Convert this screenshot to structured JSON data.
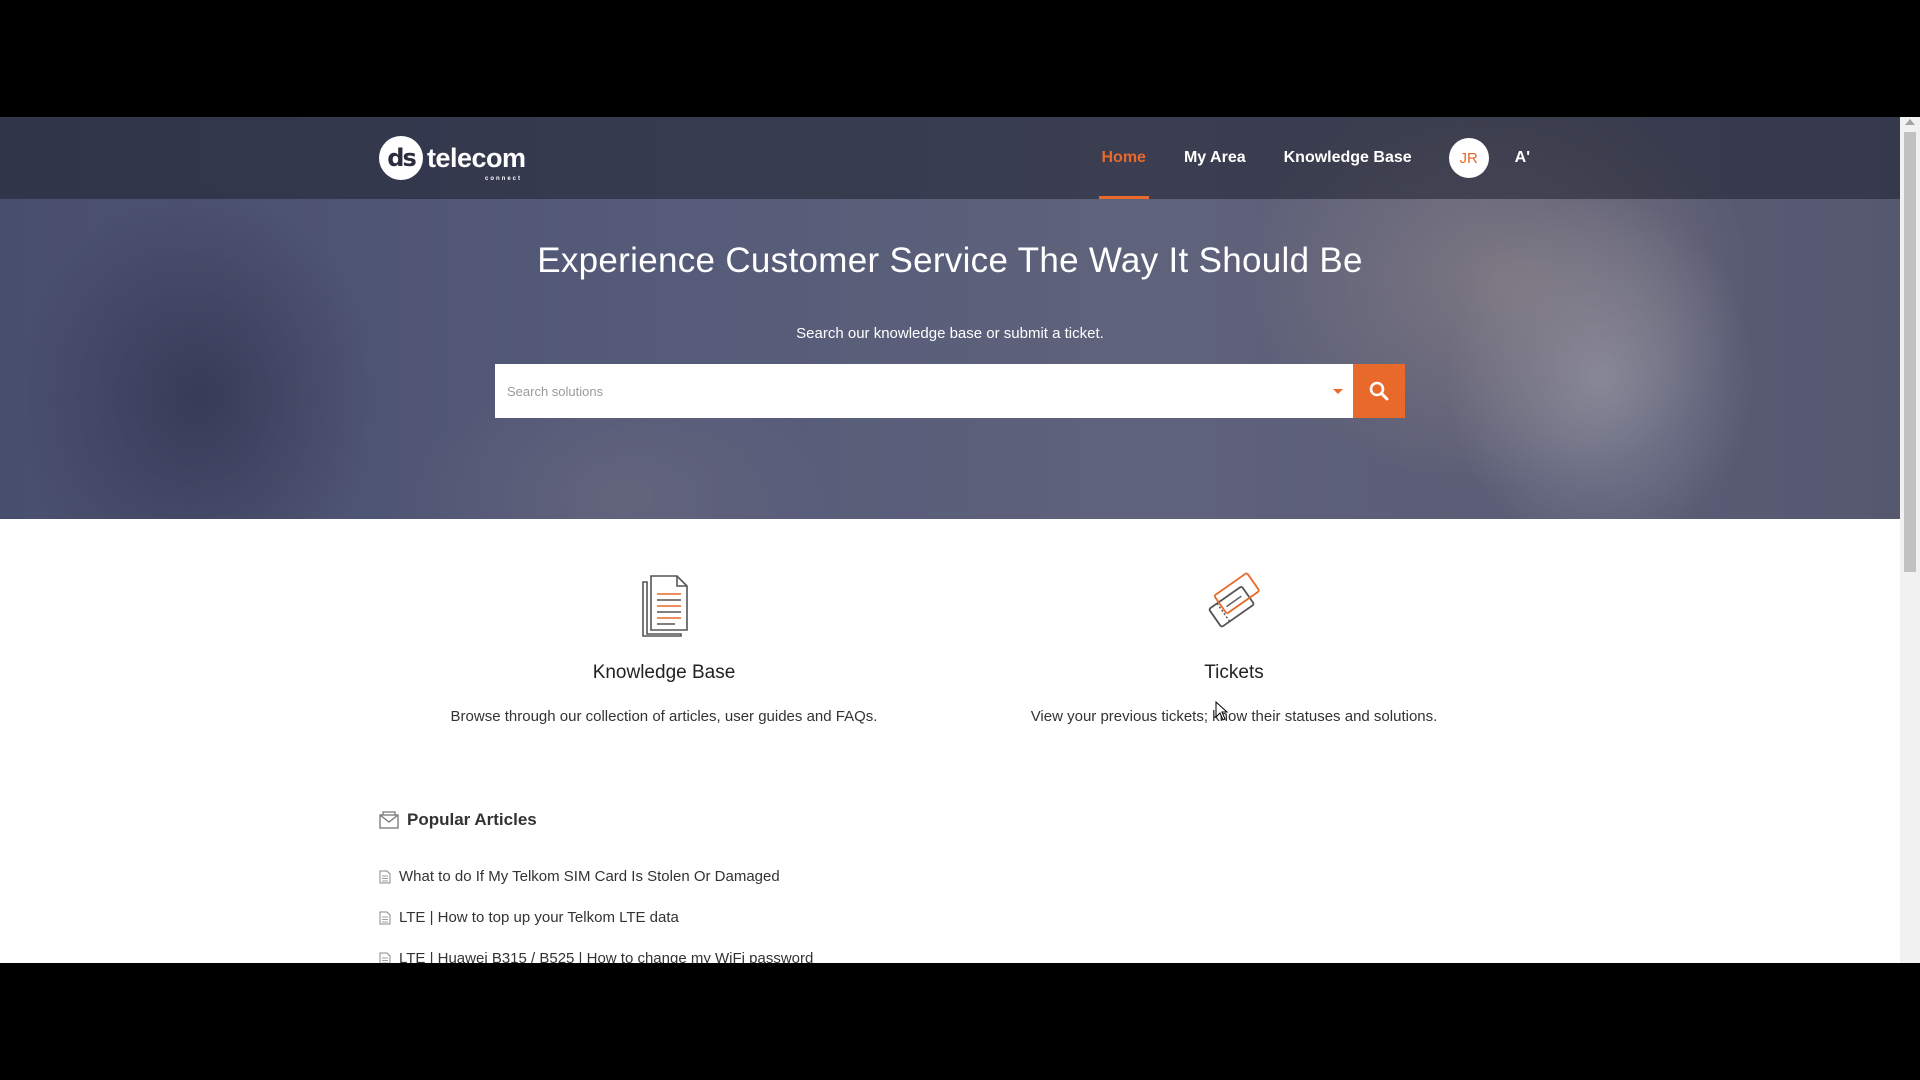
{
  "brand": {
    "logo_mark": "ds",
    "logo_text": "telecom",
    "logo_sub": "connect"
  },
  "nav": {
    "items": [
      {
        "label": "Home",
        "active": true
      },
      {
        "label": "My Area",
        "active": false
      },
      {
        "label": "Knowledge Base",
        "active": false
      }
    ],
    "avatar_initials": "JR",
    "font_toggle": "A'"
  },
  "hero": {
    "title": "Experience Customer Service The Way It Should Be",
    "subtitle": "Search our knowledge base or submit a ticket.",
    "search_placeholder": "Search solutions"
  },
  "features": [
    {
      "icon": "document-icon",
      "title": "Knowledge Base",
      "description": "Browse through our collection of articles, user guides and FAQs."
    },
    {
      "icon": "ticket-icon",
      "title": "Tickets",
      "description": "View your previous tickets; know their statuses and solutions."
    }
  ],
  "popular": {
    "heading": "Popular Articles",
    "articles": [
      "What to do If My Telkom SIM Card Is Stolen Or Damaged",
      "LTE | How to top up your Telkom LTE data",
      "LTE | Huawei B315 / B525 | How to change my WiFi password"
    ]
  },
  "colors": {
    "accent": "#e8692a",
    "text": "#333333"
  }
}
